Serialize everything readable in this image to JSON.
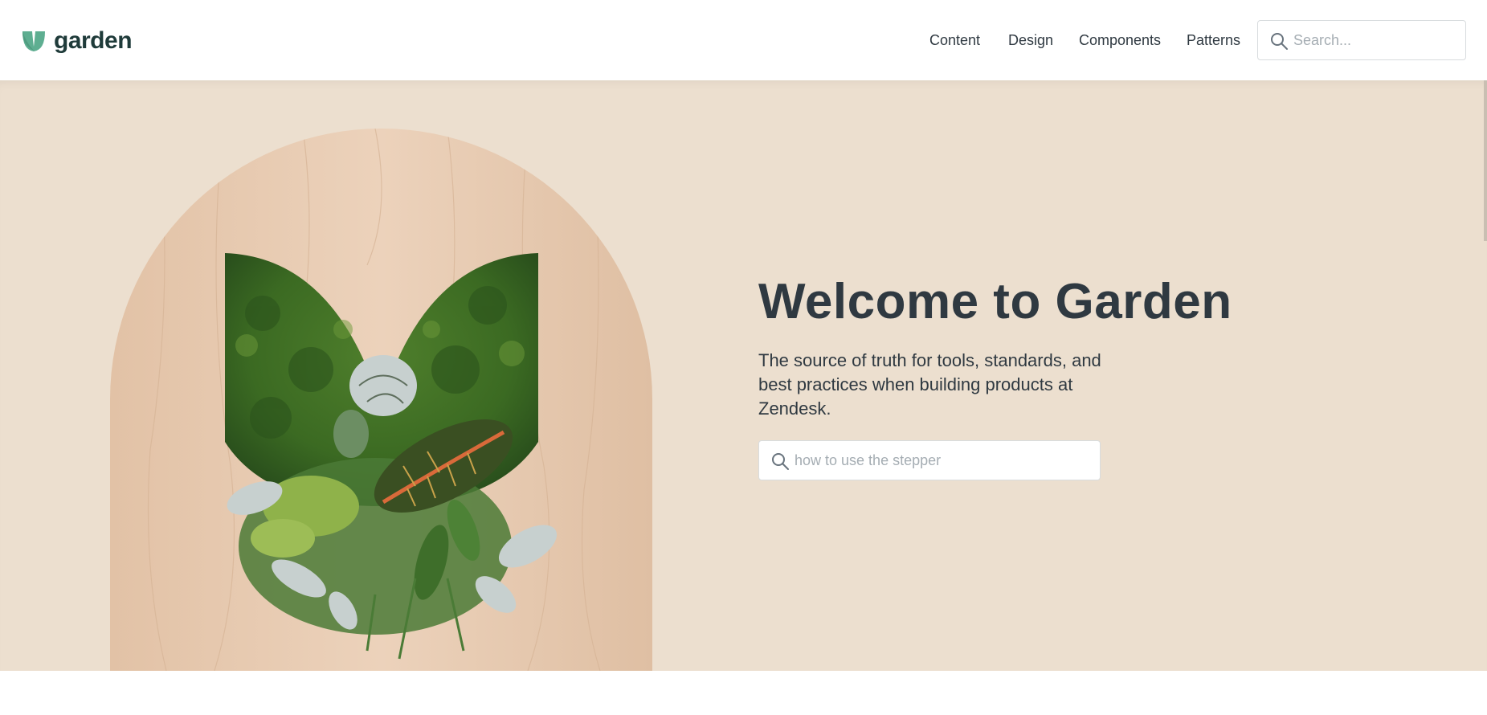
{
  "header": {
    "logo_text": "garden",
    "logo_color": "#5eae91",
    "nav": [
      {
        "label": "Content"
      },
      {
        "label": "Design"
      },
      {
        "label": "Components"
      },
      {
        "label": "Patterns"
      }
    ],
    "search": {
      "placeholder": "Search...",
      "icon": "search-icon"
    }
  },
  "hero": {
    "title": "Welcome to Garden",
    "subtitle": "The source of truth for tools, standards, and best practices when building products at Zendesk.",
    "search": {
      "placeholder": "how to use the stepper",
      "icon": "search-icon"
    },
    "background_color": "#ecdfcf",
    "image": "garden-logo-planter"
  },
  "colors": {
    "text": "#2f3941",
    "placeholder": "#a5adb3",
    "border": "#d8dcde"
  }
}
